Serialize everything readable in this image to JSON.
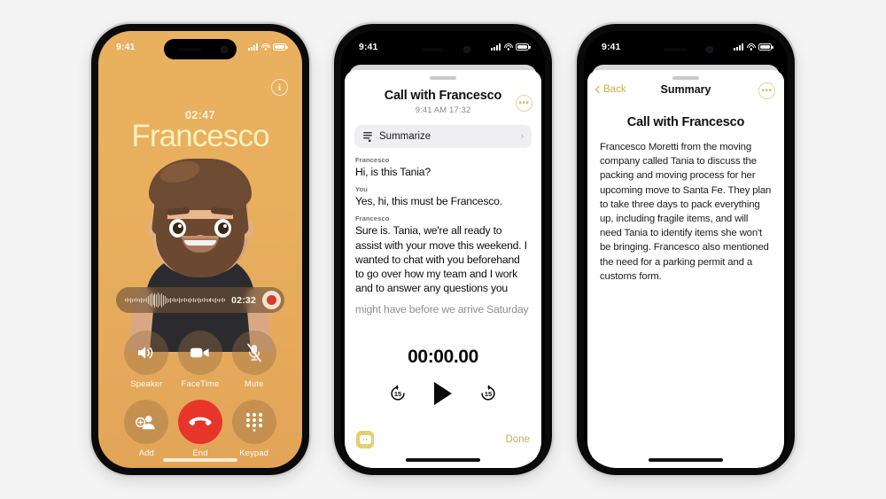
{
  "background_color": "#f4f4f4",
  "phone1": {
    "name": "in-call-screen",
    "statusbar": {
      "time": "9:41"
    },
    "accent_bg": "#e8af5f",
    "info_icon": "i",
    "call_duration": "02:47",
    "callee_name": "Francesco",
    "recording": {
      "time": "02:32",
      "record_icon": "record-dot"
    },
    "controls": [
      {
        "id": "speaker",
        "label": "Speaker",
        "icon": "speaker-icon"
      },
      {
        "id": "facetime",
        "label": "FaceTime",
        "icon": "video-camera-icon"
      },
      {
        "id": "mute",
        "label": "Mute",
        "icon": "microphone-slash-icon"
      },
      {
        "id": "add",
        "label": "Add",
        "icon": "add-person-icon"
      },
      {
        "id": "end",
        "label": "End",
        "icon": "end-call-icon",
        "color": "#e8352a"
      },
      {
        "id": "keypad",
        "label": "Keypad",
        "icon": "keypad-icon"
      }
    ]
  },
  "phone2": {
    "name": "call-transcript-sheet",
    "statusbar": {
      "time": "9:41"
    },
    "title": "Call with Francesco",
    "subtitle": "9:41 AM  17:32",
    "more_icon": "•••",
    "summarize": {
      "label": "Summarize",
      "icon": "summarize-icon",
      "chevron": "›"
    },
    "transcript": [
      {
        "speaker": "Francesco",
        "text": "Hi, is this Tania?",
        "faded": false
      },
      {
        "speaker": "You",
        "text": "Yes, hi, this must be Francesco.",
        "faded": false
      },
      {
        "speaker": "Francesco",
        "text": "Sure is. Tania, we're all ready to assist with your move this weekend. I wanted to chat with you beforehand to go over how my team and I work and to answer any questions you",
        "faded": false
      },
      {
        "speaker": "",
        "text": "might have before we arrive Saturday",
        "faded": true
      }
    ],
    "player": {
      "elapsed": "00:00.00",
      "skip_back_label": "15",
      "skip_forward_label": "15",
      "play_icon": "play-icon"
    },
    "footer": {
      "message_icon": "message-bubble-icon",
      "done_label": "Done"
    }
  },
  "phone3": {
    "name": "call-summary-sheet",
    "statusbar": {
      "time": "9:41"
    },
    "nav": {
      "back_label": "Back",
      "title": "Summary",
      "more_icon": "•••"
    },
    "title": "Call with Francesco",
    "summary": "Francesco Moretti from the moving company called Tania to discuss the packing and moving process for her upcoming move to Santa Fe. They plan to take three days to pack everything up, including fragile items, and will need Tania to identify items she won't be bringing. Francesco also mentioned the need for a parking permit and a customs form."
  }
}
